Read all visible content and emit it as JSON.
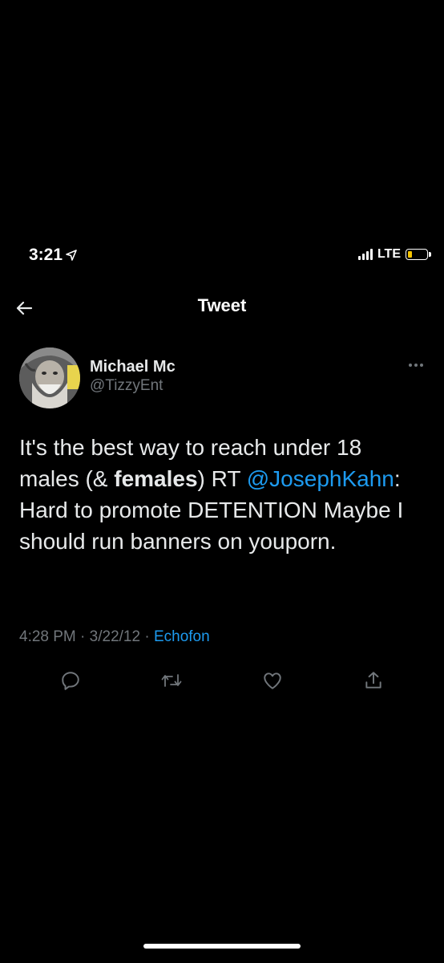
{
  "status_bar": {
    "time": "3:21",
    "network": "LTE",
    "battery_color": "#f5c400",
    "battery_level": 0.25
  },
  "header": {
    "title": "Tweet"
  },
  "author": {
    "name": "Michael Mc",
    "handle": "@TizzyEnt"
  },
  "tweet": {
    "text_part1": "It's the best way to reach under 18 males (& ",
    "text_bold": "females",
    "text_part2": ")  RT ",
    "mention": "@JosephKahn",
    "text_part3": ": Hard to promote DETENTION Maybe I should run banners on youporn."
  },
  "meta": {
    "time": "4:28 PM",
    "separator1": " · ",
    "date": "3/22/12",
    "separator2": " · ",
    "source": "Echofon"
  },
  "actions": [
    {
      "icon": "reply-icon"
    },
    {
      "icon": "retweet-icon"
    },
    {
      "icon": "like-icon"
    },
    {
      "icon": "share-icon"
    }
  ],
  "colors": {
    "background": "#000000",
    "text": "#e7e9ea",
    "secondary": "#71767b",
    "accent": "#1d9bf0"
  }
}
